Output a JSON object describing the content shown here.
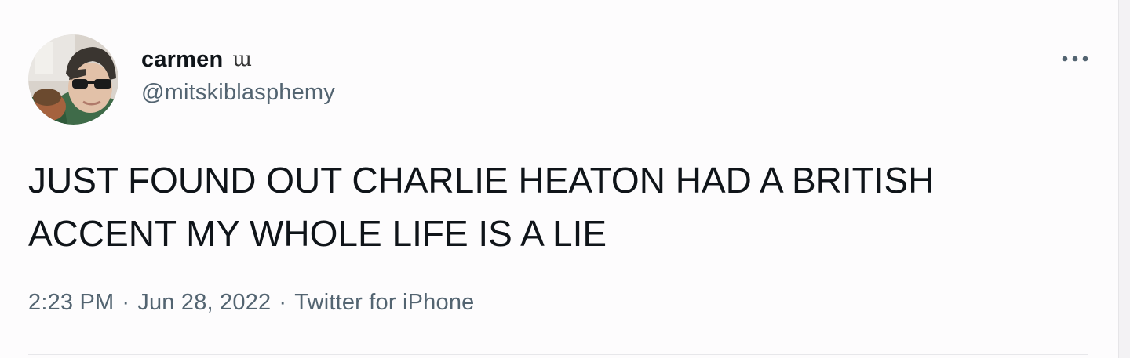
{
  "tweet": {
    "author": {
      "display_name": "carmen",
      "name_emoji": "ɯ",
      "handle": "@mitskiblasphemy",
      "avatar_icon": "profile-photo"
    },
    "text": "JUST FOUND OUT CHARLIE HEATON HAD A BRITISH\nACCENT MY WHOLE LIFE IS A LIE",
    "meta": {
      "time": "2:23 PM",
      "separator": "·",
      "date": "Jun 28, 2022",
      "source": "Twitter for iPhone"
    },
    "more_icon": "more-horizontal-icon"
  },
  "colors": {
    "background": "#fdfcfd",
    "text_primary": "#0f1419",
    "text_secondary": "#536471"
  }
}
